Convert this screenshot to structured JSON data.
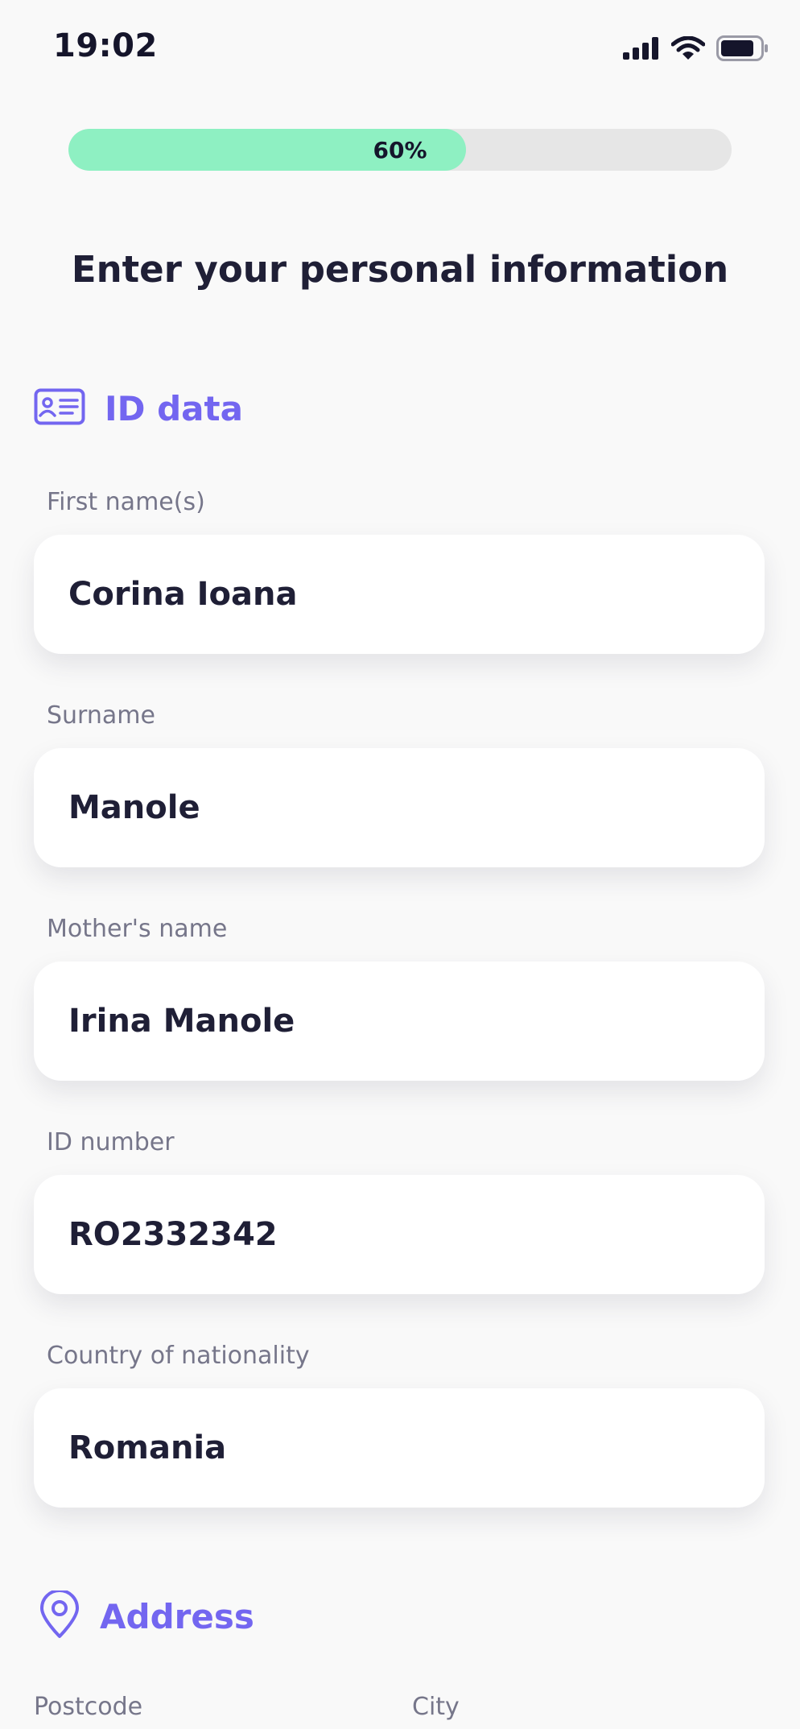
{
  "status_bar": {
    "time": "19:02",
    "icons": [
      "cellular-signal-icon",
      "wifi-icon",
      "battery-icon"
    ]
  },
  "progress": {
    "label": "60%",
    "percent": 60,
    "fill_color": "#8ef0c2",
    "track_color": "#e6e6e6"
  },
  "title": "Enter your personal information",
  "accent_color": "#7366f0",
  "id_section": {
    "icon": "id-card-icon",
    "title": "ID data",
    "fields": [
      {
        "label": "First name(s)",
        "value": "Corina Ioana"
      },
      {
        "label": "Surname",
        "value": "Manole"
      },
      {
        "label": "Mother's name",
        "value": "Irina Manole"
      },
      {
        "label": "ID number",
        "value": "RO2332342"
      },
      {
        "label": "Country of nationality",
        "value": "Romania"
      }
    ]
  },
  "address_section": {
    "icon": "location-pin-icon",
    "title": "Address",
    "fields": [
      {
        "label": "Postcode"
      },
      {
        "label": "City"
      }
    ]
  }
}
